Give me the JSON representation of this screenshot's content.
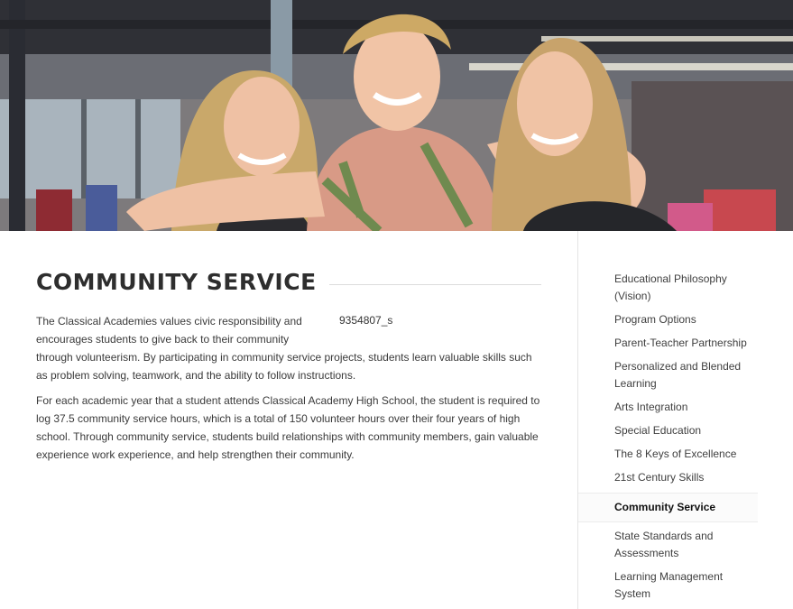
{
  "hero": {
    "image_description": "three smiling students"
  },
  "page": {
    "title": "COMMUNITY SERVICE",
    "image_alt": "9354807_s",
    "paragraph_1": "The Classical Academies values civic responsibility and encourages students to give back to their community through volunteerism. By participating in community service projects, students learn valuable skills such as problem solving, teamwork, and the ability to follow instructions.",
    "paragraph_2": "For each academic year that a student attends Classical Academy High School, the student is required to log 37.5 community service hours, which is a total of 150 volunteer hours over their four years of high school. Through community service, students build relationships with community members, gain valuable experience work experience, and help strengthen their community."
  },
  "sidebar": {
    "items": [
      {
        "label": "Educational Philosophy (Vision)"
      },
      {
        "label": "Program Options"
      },
      {
        "label": "Parent-Teacher Partnership"
      },
      {
        "label": "Personalized and Blended Learning"
      },
      {
        "label": "Arts Integration"
      },
      {
        "label": "Special Education"
      },
      {
        "label": "The 8 Keys of Excellence"
      },
      {
        "label": "21st Century Skills"
      },
      {
        "label": "Community Service",
        "active": true
      },
      {
        "label": "State Standards and Assessments"
      },
      {
        "label": "Learning Management System"
      }
    ]
  },
  "colors": {
    "text": "#3a3a3a",
    "title": "#2e2e2e",
    "active_item": "#111111",
    "divider": "#e4e4e4"
  }
}
